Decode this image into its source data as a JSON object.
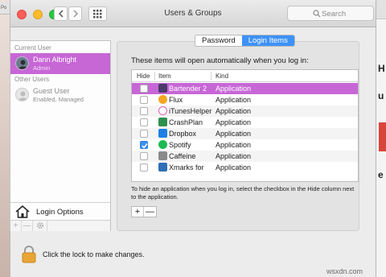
{
  "background": {
    "left_tab": "Po",
    "right_letters": [
      "H",
      "u",
      "e"
    ]
  },
  "window": {
    "title": "Users & Groups",
    "search_placeholder": "Search"
  },
  "sidebar": {
    "current_user_header": "Current User",
    "current_user": {
      "name": "Dann Albright",
      "role": "Admin"
    },
    "other_users_header": "Other Users",
    "other_users": [
      {
        "name": "Guest User",
        "status": "Enabled, Managed"
      }
    ],
    "login_options_label": "Login Options",
    "add_symbol": "+",
    "remove_symbol": "—"
  },
  "tabs": [
    {
      "label": "Password",
      "selected": false
    },
    {
      "label": "Login Items",
      "selected": true
    }
  ],
  "login_items": {
    "intro": "These items will open automatically when you log in:",
    "columns": {
      "hide": "Hide",
      "item": "Item",
      "kind": "Kind"
    },
    "rows": [
      {
        "name": "Bartender 2",
        "kind": "Application",
        "hidden": false,
        "selected": true,
        "icon": "bartender-icon",
        "color": "#4a3a6b"
      },
      {
        "name": "Flux",
        "kind": "Application",
        "hidden": false,
        "selected": false,
        "icon": "flux-icon",
        "color": "#f5a623"
      },
      {
        "name": "iTunesHelper",
        "kind": "Application",
        "hidden": false,
        "selected": false,
        "icon": "itunes-icon",
        "color": "#e35fb6"
      },
      {
        "name": "CrashPlan",
        "kind": "Application",
        "hidden": false,
        "selected": false,
        "icon": "crashplan-icon",
        "color": "#2f8f4e"
      },
      {
        "name": "Dropbox",
        "kind": "Application",
        "hidden": false,
        "selected": false,
        "icon": "dropbox-icon",
        "color": "#1f7fe5"
      },
      {
        "name": "Spotify",
        "kind": "Application",
        "hidden": true,
        "selected": false,
        "icon": "spotify-icon",
        "color": "#1db954"
      },
      {
        "name": "Caffeine",
        "kind": "Application",
        "hidden": false,
        "selected": false,
        "icon": "caffeine-icon",
        "color": "#8a8a8a"
      },
      {
        "name": "Xmarks for",
        "kind": "Application",
        "hidden": false,
        "selected": false,
        "icon": "xmarks-icon",
        "color": "#2f6fb7"
      }
    ],
    "help": "To hide an application when you log in, select the checkbox in the Hide column next to the application.",
    "add_symbol": "+",
    "remove_symbol": "—"
  },
  "footer": {
    "lock_text": "Click the lock to make changes."
  },
  "watermark": "wsxdn.com",
  "colors": {
    "selection": "#c767d6",
    "accent": "#3d92f7"
  }
}
